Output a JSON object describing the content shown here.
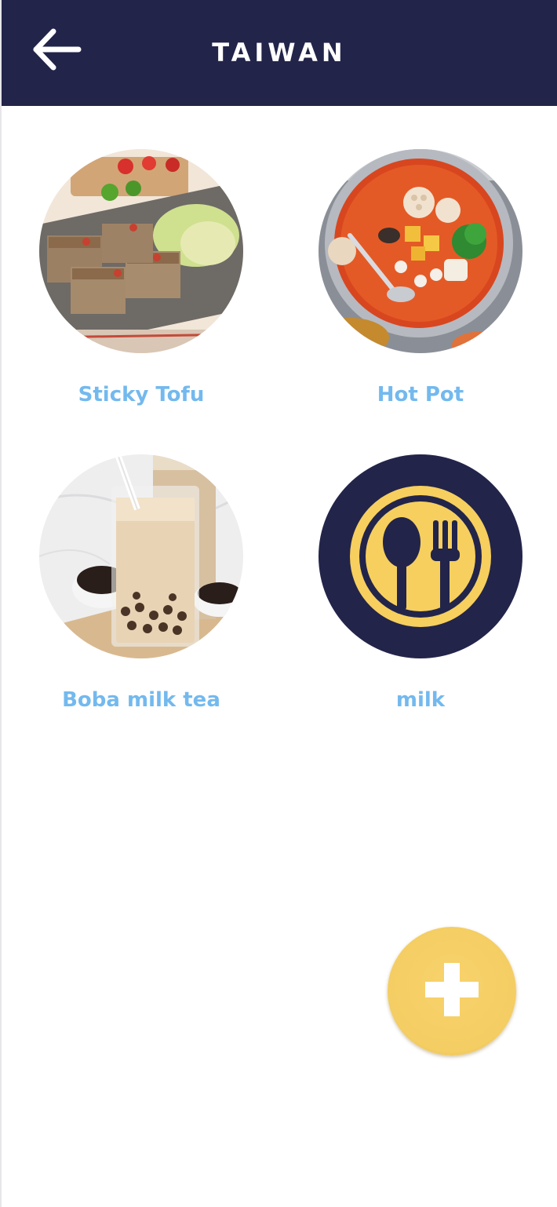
{
  "header": {
    "back_icon": "arrow-left-icon",
    "title": "TAIWAN"
  },
  "foods": [
    {
      "name": "Sticky Tofu",
      "image": "sticky-tofu-photo"
    },
    {
      "name": "Hot Pot",
      "image": "hot-pot-photo"
    },
    {
      "name": "Boba milk tea",
      "image": "boba-milk-tea-photo"
    },
    {
      "name": "milk",
      "image": "utensils-placeholder-icon"
    }
  ],
  "fab": {
    "icon": "plus-icon"
  },
  "colors": {
    "header_bg": "#22244a",
    "label": "#73b9ee",
    "fab": "#f4cd63",
    "placeholder_bg": "#22244a",
    "placeholder_fg": "#f6cf5e"
  }
}
